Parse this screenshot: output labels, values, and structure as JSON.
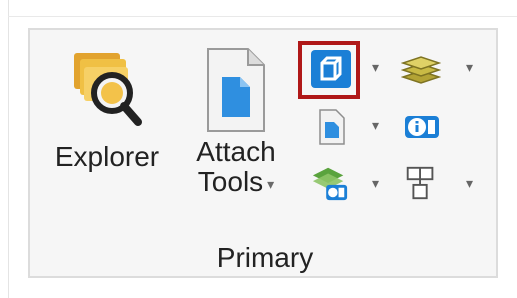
{
  "ribbon": {
    "group_label": "Primary",
    "explorer": {
      "label": "Explorer",
      "icon": "folder-search-icon"
    },
    "attach_tools": {
      "line1": "Attach",
      "line2": "Tools",
      "caret": "▾",
      "icon": "document-icon"
    },
    "small_buttons": [
      {
        "name": "view-box-button",
        "icon": "cube-icon",
        "highlighted": true
      },
      {
        "name": "layers-button",
        "icon": "layers-stack-icon"
      },
      {
        "name": "document-button",
        "icon": "page-icon"
      },
      {
        "name": "info-display-button",
        "icon": "info-badge-icon"
      },
      {
        "name": "layer-info-button",
        "icon": "layers-info-icon"
      },
      {
        "name": "level-button",
        "icon": "tree-grid-icon"
      }
    ],
    "caret_glyph": "▾"
  },
  "colors": {
    "highlight_border": "#b01818",
    "accent_blue": "#1b7fd6",
    "panel_bg": "#f6f6f6"
  }
}
